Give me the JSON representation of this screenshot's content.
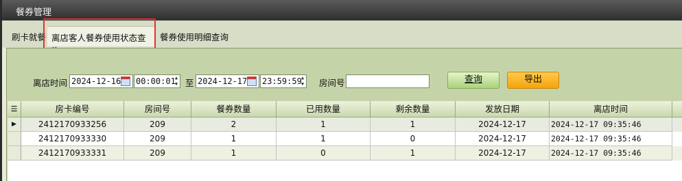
{
  "window": {
    "title": "餐券管理"
  },
  "tabs": [
    {
      "label": "刷卡就餐"
    },
    {
      "label": "离店客人餐券使用状态查询"
    },
    {
      "label": "餐券使用明细查询"
    }
  ],
  "filters": {
    "checkout_time_label": "离店时间",
    "start_date": "2024-12-16",
    "start_time": "00:00:01",
    "to_label": "至",
    "end_date": "2024-12-17",
    "end_time": "23:59:59",
    "room_label": "房间号",
    "room_value": ""
  },
  "buttons": {
    "query": "查询",
    "export": "导出"
  },
  "table": {
    "columns": [
      "房卡编号",
      "房间号",
      "餐券数量",
      "已用数量",
      "剩余数量",
      "发放日期",
      "离店时间"
    ],
    "rows": [
      [
        "2412170933256",
        "209",
        "2",
        "1",
        "1",
        "2024-12-17",
        "2024-12-17 09:35:46"
      ],
      [
        "2412170933330",
        "209",
        "1",
        "1",
        "0",
        "2024-12-17",
        "2024-12-17 09:35:46"
      ],
      [
        "2412170933331",
        "209",
        "1",
        "0",
        "1",
        "2024-12-17",
        "2024-12-17 09:35:46"
      ]
    ]
  }
}
